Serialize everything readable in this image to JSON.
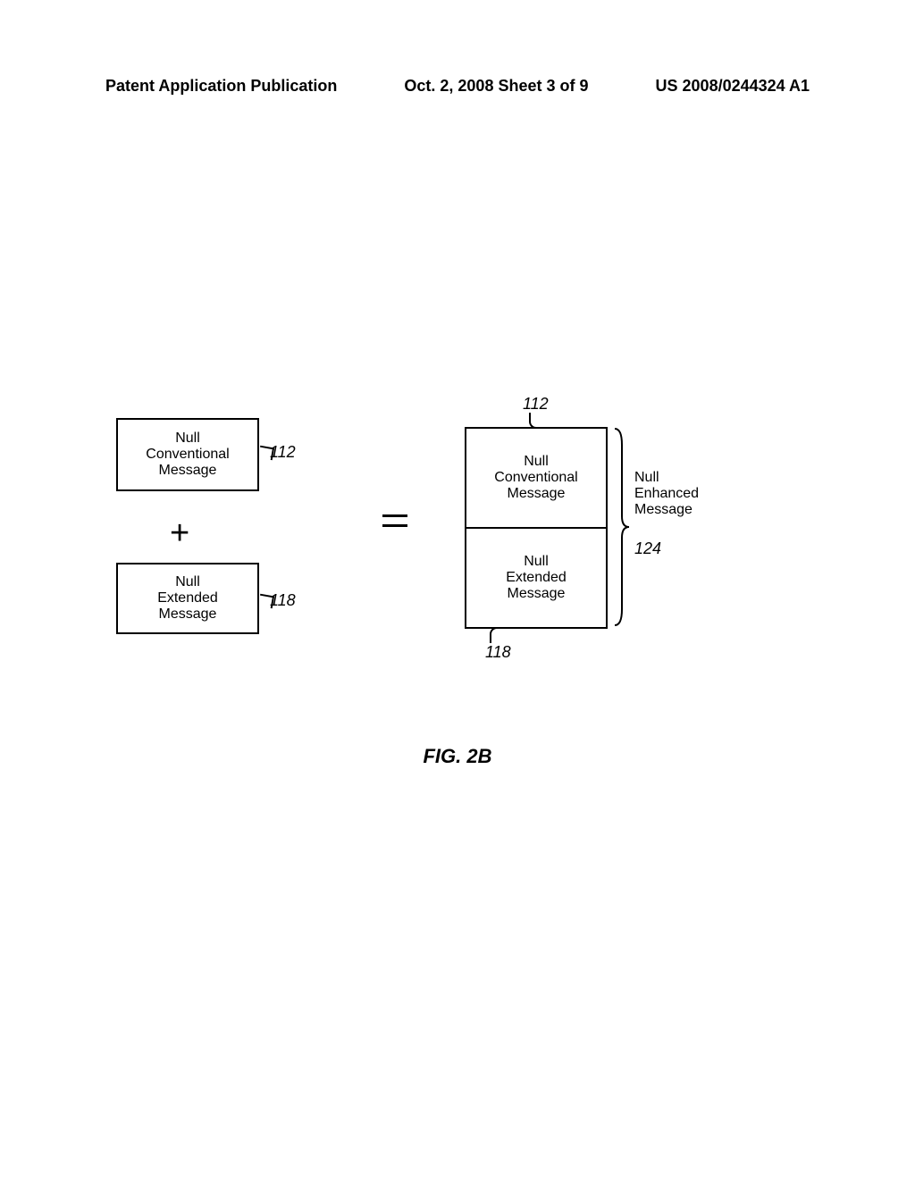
{
  "header": {
    "left": "Patent Application Publication",
    "center": "Oct. 2, 2008  Sheet 3 of 9",
    "right": "US 2008/0244324 A1"
  },
  "boxes": {
    "null_conventional": "Null\nConventional\nMessage",
    "null_extended": "Null\nExtended\nMessage",
    "null_enhanced": "Null\nEnhanced\nMessage"
  },
  "refs": {
    "nc": "112",
    "ne": "118",
    "nem": "124"
  },
  "figure": "FIG. 2B"
}
